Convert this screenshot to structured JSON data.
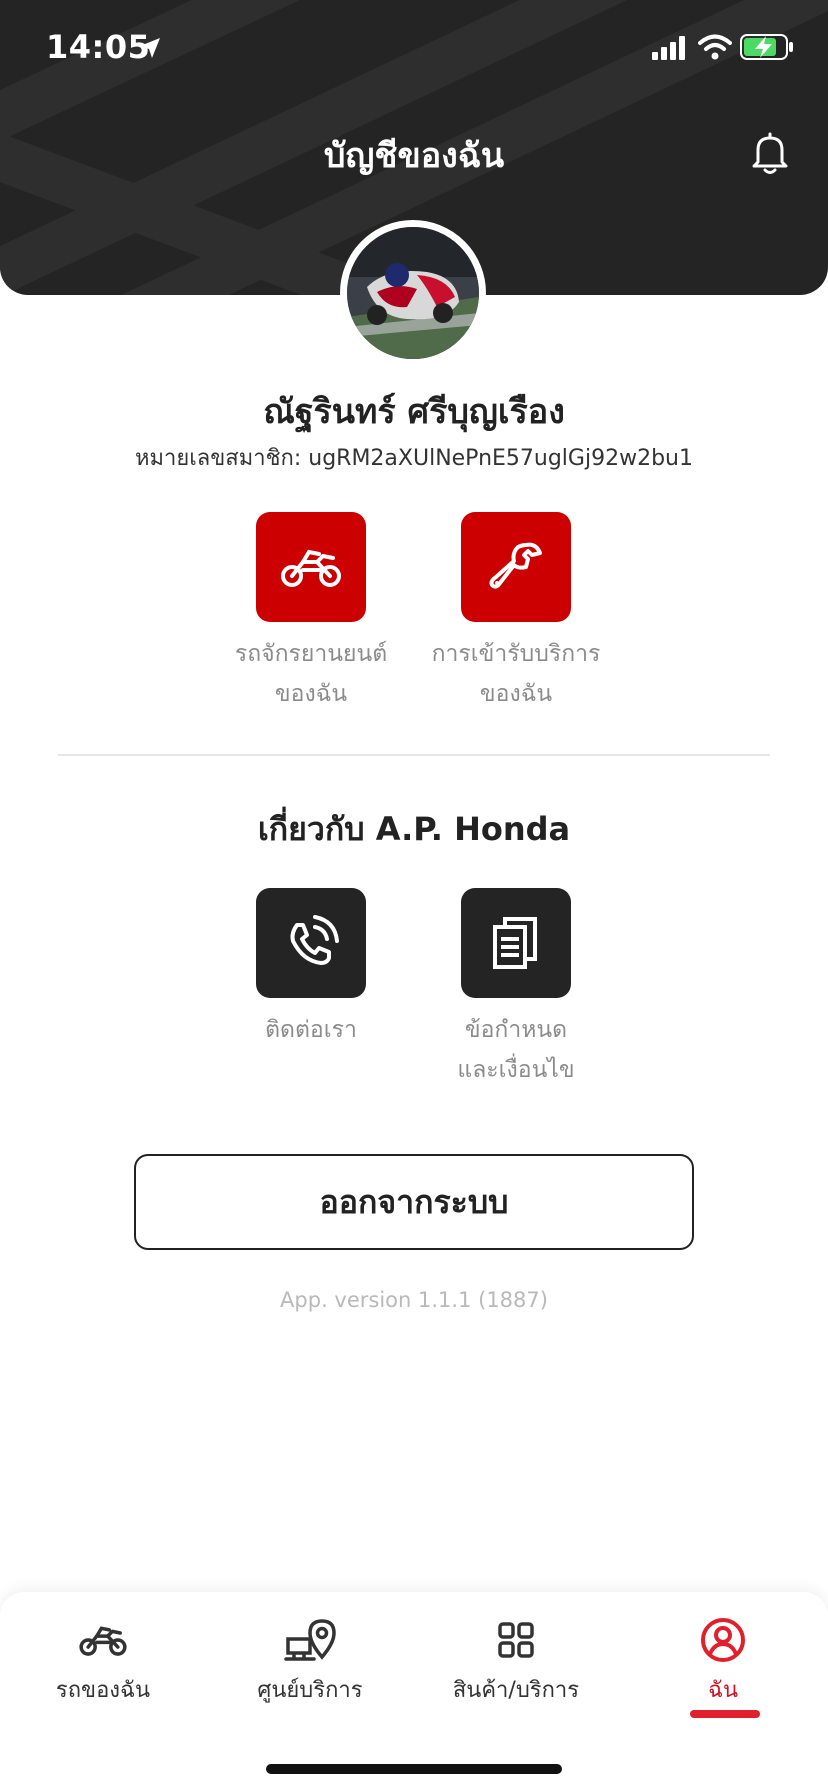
{
  "status_bar": {
    "time": "14:05"
  },
  "header": {
    "title": "บัญชีของฉัน"
  },
  "profile": {
    "name": "ณัฐรินทร์ ศรีบุญเรือง",
    "member_label": "หมายเลขสมาชิก:",
    "member_id": "ugRM2aXUlNePnE57uglGj92w2bu1"
  },
  "quick_actions": [
    {
      "icon": "motorcycle-icon",
      "line1": "รถจักรยานยนต์",
      "line2": "ของฉัน"
    },
    {
      "icon": "wrench-icon",
      "line1": "การเข้ารับบริการ",
      "line2": "ของฉัน"
    }
  ],
  "about": {
    "title": "เกี่ยวกับ A.P. Honda",
    "items": [
      {
        "icon": "phone-icon",
        "line1": "ติดต่อเรา",
        "line2": ""
      },
      {
        "icon": "document-icon",
        "line1": "ข้อกำหนด",
        "line2": "และเงื่อนไข"
      }
    ]
  },
  "logout_label": "ออกจากระบบ",
  "app_version": "App. version 1.1.1 (1887)",
  "tabs": [
    {
      "label": "รถของฉัน",
      "icon": "motorcycle-icon",
      "active": false
    },
    {
      "label": "ศูนย์บริการ",
      "icon": "service-center-icon",
      "active": false
    },
    {
      "label": "สินค้า/บริการ",
      "icon": "grid-icon",
      "active": false
    },
    {
      "label": "ฉัน",
      "icon": "profile-icon",
      "active": true
    }
  ],
  "colors": {
    "accent": "#cc0000",
    "dark": "#242424",
    "active_tab": "#e0202c"
  }
}
